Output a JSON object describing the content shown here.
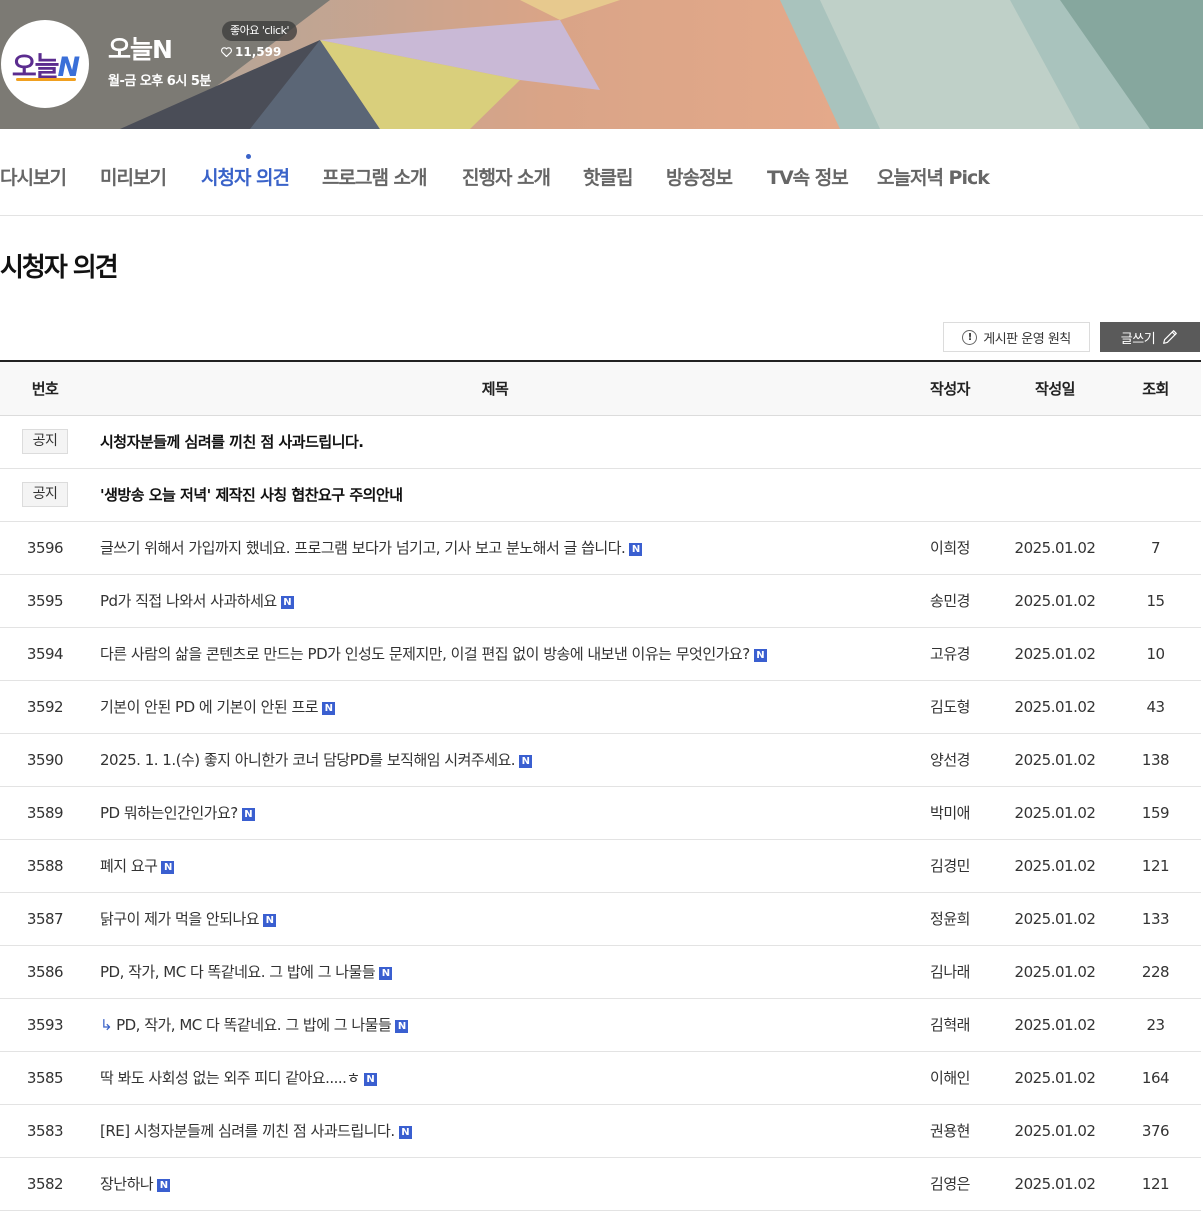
{
  "header": {
    "program_title": "오늘N",
    "schedule": "월-금 오후 6시 5분",
    "like_tooltip": "좋아요 'click'",
    "like_count": "11,599",
    "logo_text_main": "오늘",
    "logo_text_accent": "N"
  },
  "tabs": [
    {
      "label": "다시보기"
    },
    {
      "label": "미리보기"
    },
    {
      "label": "시청자 의견"
    },
    {
      "label": "프로그램 소개"
    },
    {
      "label": "진행자 소개"
    },
    {
      "label": "핫클립"
    },
    {
      "label": "방송정보"
    },
    {
      "label": "TV속 정보"
    },
    {
      "label": "오늘저녁 Pick"
    }
  ],
  "active_tab": "시청자 의견",
  "page_heading": "시청자 의견",
  "actions": {
    "rules_label": "게시판 운영 원칙",
    "rules_icon": "!",
    "write_label": "글쓰기"
  },
  "table": {
    "headers": {
      "num": "번호",
      "title": "제목",
      "author": "작성자",
      "date": "작성일",
      "views": "조회"
    },
    "notice_label": "공지",
    "new_badge": "N",
    "reply_marker": "↳",
    "notices": [
      {
        "title": "시청자분들께 심려를 끼친 점 사과드립니다."
      },
      {
        "title": "'생방송 오늘 저녁' 제작진 사칭 협찬요구 주의안내"
      }
    ],
    "rows": [
      {
        "num": "3596",
        "title": "글쓰기 위해서 가입까지 했네요. 프로그램 보다가 넘기고, 기사 보고 분노해서 글 씁니다.",
        "author": "이희정",
        "date": "2025.01.02",
        "views": "7"
      },
      {
        "num": "3595",
        "title": "Pd가 직접 나와서 사과하세요",
        "author": "송민경",
        "date": "2025.01.02",
        "views": "15"
      },
      {
        "num": "3594",
        "title": "다른 사람의 삶을 콘텐츠로 만드는 PD가 인성도 문제지만, 이걸 편집 없이 방송에 내보낸 이유는 무엇인가요?",
        "author": "고유경",
        "date": "2025.01.02",
        "views": "10"
      },
      {
        "num": "3592",
        "title": "기본이 안된 PD 에 기본이 안된 프로",
        "author": "김도형",
        "date": "2025.01.02",
        "views": "43"
      },
      {
        "num": "3590",
        "title": "2025. 1. 1.(수) 좋지 아니한가 코너 담당PD를 보직해임 시켜주세요.",
        "author": "양선경",
        "date": "2025.01.02",
        "views": "138"
      },
      {
        "num": "3589",
        "title": "PD 뭐하는인간인가요?",
        "author": "박미애",
        "date": "2025.01.02",
        "views": "159"
      },
      {
        "num": "3588",
        "title": "폐지 요구",
        "author": "김경민",
        "date": "2025.01.02",
        "views": "121"
      },
      {
        "num": "3587",
        "title": "닭구이 제가 먹을 안되나요",
        "author": "정윤희",
        "date": "2025.01.02",
        "views": "133"
      },
      {
        "num": "3586",
        "title": "PD, 작가, MC 다 똑같네요. 그 밥에 그 나물들",
        "author": "김나래",
        "date": "2025.01.02",
        "views": "228"
      },
      {
        "num": "3593",
        "title": "PD, 작가, MC 다 똑같네요. 그 밥에 그 나물들",
        "author": "김혁래",
        "date": "2025.01.02",
        "views": "23",
        "reply": true
      },
      {
        "num": "3585",
        "title": "딱 봐도 사회성 없는 외주 피디 같아요.....ㅎ",
        "author": "이해인",
        "date": "2025.01.02",
        "views": "164"
      },
      {
        "num": "3583",
        "title": "[RE] 시청자분들께 심려를 끼친 점 사과드립니다.",
        "author": "권용현",
        "date": "2025.01.02",
        "views": "376"
      },
      {
        "num": "3582",
        "title": "장난하나",
        "author": "김영은",
        "date": "2025.01.02",
        "views": "121"
      }
    ]
  }
}
